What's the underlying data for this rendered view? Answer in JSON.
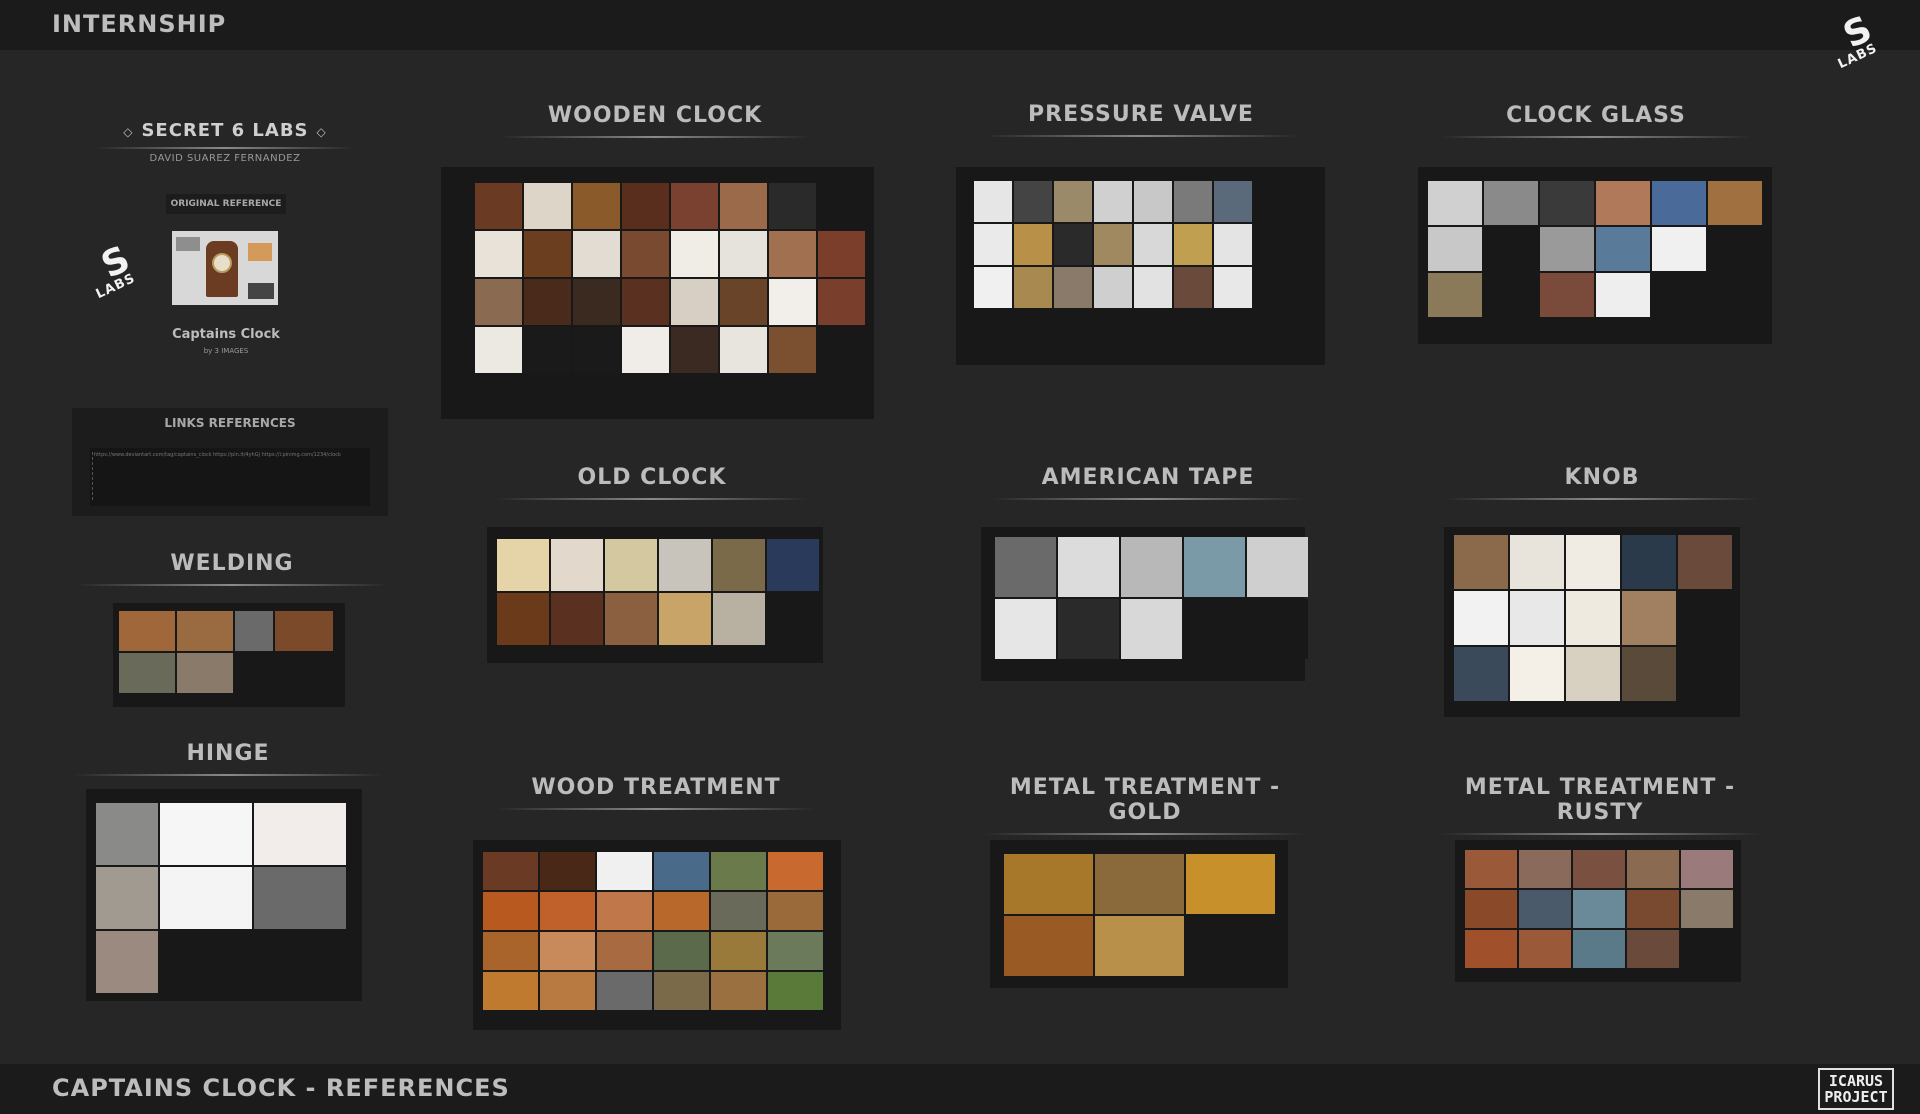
{
  "header": {
    "title": "INTERNSHIP"
  },
  "footer": {
    "title": "CAPTAINS CLOCK - REFERENCES",
    "brand": "ICARUS PROJECT",
    "brand_line1": "ICARUS",
    "brand_line2": "PROJECT"
  },
  "logo": {
    "glyph": "S",
    "text": "LABS"
  },
  "sidebar": {
    "brand": "SECRET 6 LABS",
    "author": "DAVID SUAREZ FERNANDEZ",
    "original_reference_label": "ORIGINAL REFERENCE",
    "reference_title": "Captains Clock",
    "reference_subtitle": "by 3 IMAGES",
    "links_label": "LINKS REFERENCES",
    "links_text": "https://www.deviantart.com/tag/captains_clock  https://pin.it/4yhGj  https://i.pinimg.com/1234/clock"
  },
  "sections": {
    "wooden_clock": "WOODEN CLOCK",
    "pressure_valve": "PRESSURE VALVE",
    "clock_glass": "CLOCK GLASS",
    "old_clock": "OLD CLOCK",
    "american_tape": "AMERICAN TAPE",
    "knob": "KNOB",
    "welding": "WELDING",
    "hinge": "HINGE",
    "wood_treatment": "WOOD TREATMENT",
    "metal_gold": "METAL TREATMENT - GOLD",
    "metal_rusty": "METAL TREATMENT - RUSTY"
  },
  "colors": {
    "background": "#262626",
    "bars": "#1b1b1b",
    "panel": "#181818",
    "title_text": "#bcbcbc"
  }
}
